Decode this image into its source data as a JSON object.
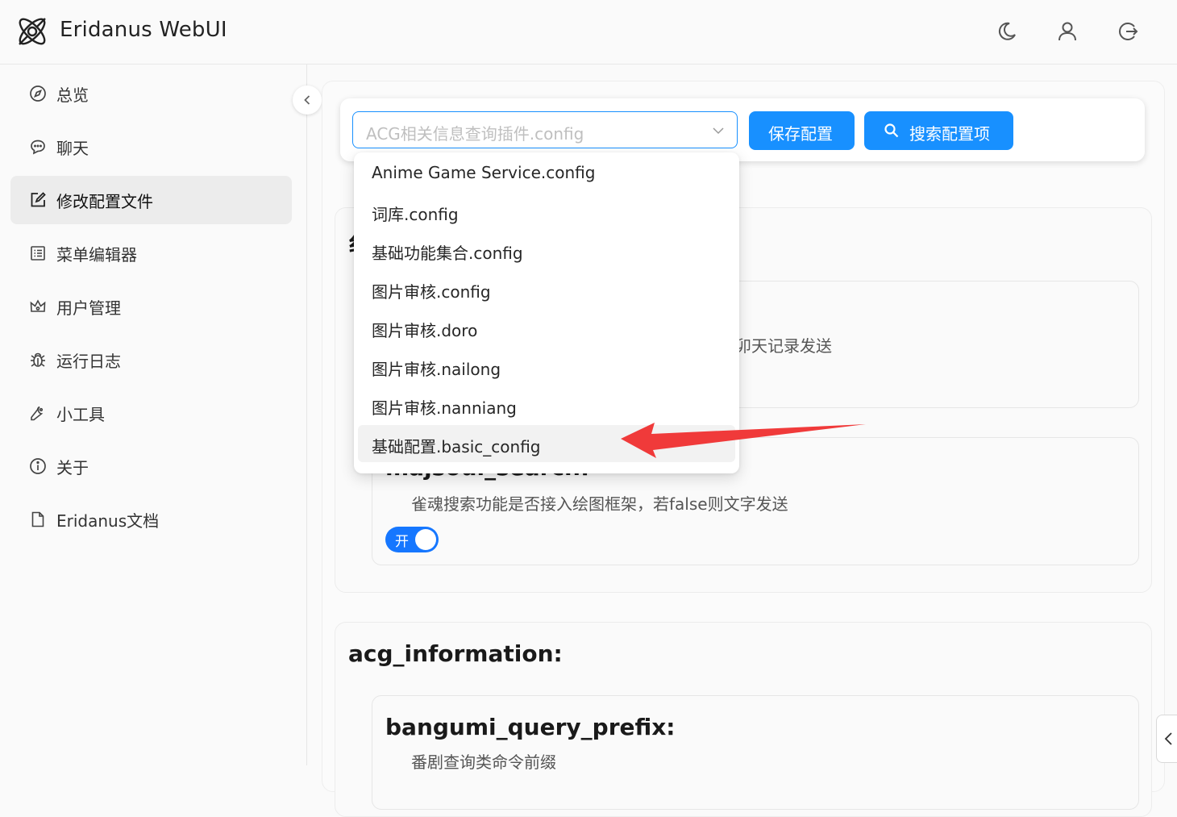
{
  "app": {
    "title": "Eridanus WebUI",
    "icons": [
      "logo-icon",
      "moon-icon",
      "user-icon",
      "logout-icon"
    ]
  },
  "sidebar": {
    "items": [
      {
        "label": "总览",
        "icon": "compass-icon"
      },
      {
        "label": "聊天",
        "icon": "chat-icon"
      },
      {
        "label": "修改配置文件",
        "icon": "edit-icon",
        "active": true
      },
      {
        "label": "菜单编辑器",
        "icon": "list-icon"
      },
      {
        "label": "用户管理",
        "icon": "crown-icon"
      },
      {
        "label": "运行日志",
        "icon": "bug-icon"
      },
      {
        "label": "小工具",
        "icon": "tool-icon"
      },
      {
        "label": "关于",
        "icon": "info-icon"
      },
      {
        "label": "Eridanus文档",
        "icon": "file-icon"
      }
    ]
  },
  "toolbar": {
    "select_placeholder": "ACG相关信息查询插件.config",
    "save_label": "保存配置",
    "search_label": "搜索配置项"
  },
  "dropdown": {
    "options": [
      "Anime Game Service.config",
      "词库.config",
      "基础功能集合.config",
      "图片审核.config",
      "图片审核.doro",
      "图片审核.nailong",
      "图片审核.nanniang",
      "基础配置.basic_config"
    ],
    "highlighted_index": 7
  },
  "sections": [
    {
      "heading_partial": "纟",
      "items": [
        {
          "desc_partial": "卯天记录发送"
        },
        {
          "title_partial": "majsoul_search:",
          "desc": "雀魂搜索功能是否接入绘图框架，若false则文字发送",
          "toggle_label": "开",
          "toggle_on": true
        }
      ]
    },
    {
      "heading": "acg_information:",
      "items": [
        {
          "title": "bangumi_query_prefix:",
          "desc": "番剧查询类命令前缀"
        }
      ]
    }
  ],
  "colors": {
    "primary": "#1890ff",
    "toggle": "#1677ff",
    "arrow": "#f03a3a",
    "active_nav": "#ececec"
  }
}
